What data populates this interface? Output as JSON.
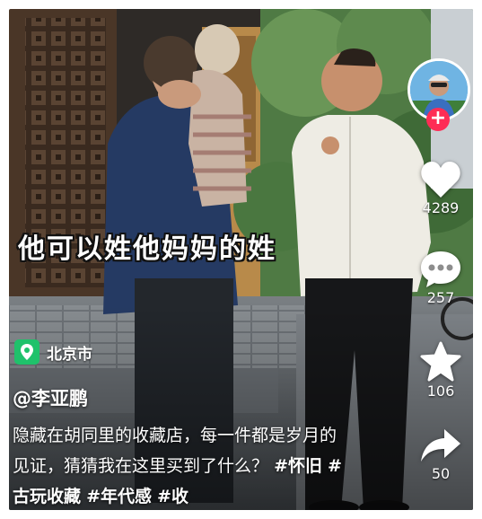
{
  "video": {
    "subtitle": "他可以姓他妈妈的姓"
  },
  "location": {
    "icon": "location-pin-icon",
    "label": "北京市",
    "badge_color": "#1fc26b"
  },
  "author": {
    "handle": "@李亚鹏"
  },
  "description": {
    "text": "隐藏在胡同里的收藏店，每一件都是岁月的见证，猜猜我在这里买到了什么？",
    "hashtags": [
      "#怀旧",
      "#古玩收藏",
      "#年代感",
      "#收"
    ]
  },
  "sidebar": {
    "follow_icon": "plus-icon",
    "follow_color": "#fe2c55",
    "like": {
      "icon": "heart-icon",
      "count": "4289"
    },
    "comment": {
      "icon": "comment-bubble-icon",
      "count": "257"
    },
    "favorite": {
      "icon": "star-icon",
      "count": "106"
    },
    "share": {
      "icon": "share-arrow-icon",
      "count": "50"
    }
  }
}
